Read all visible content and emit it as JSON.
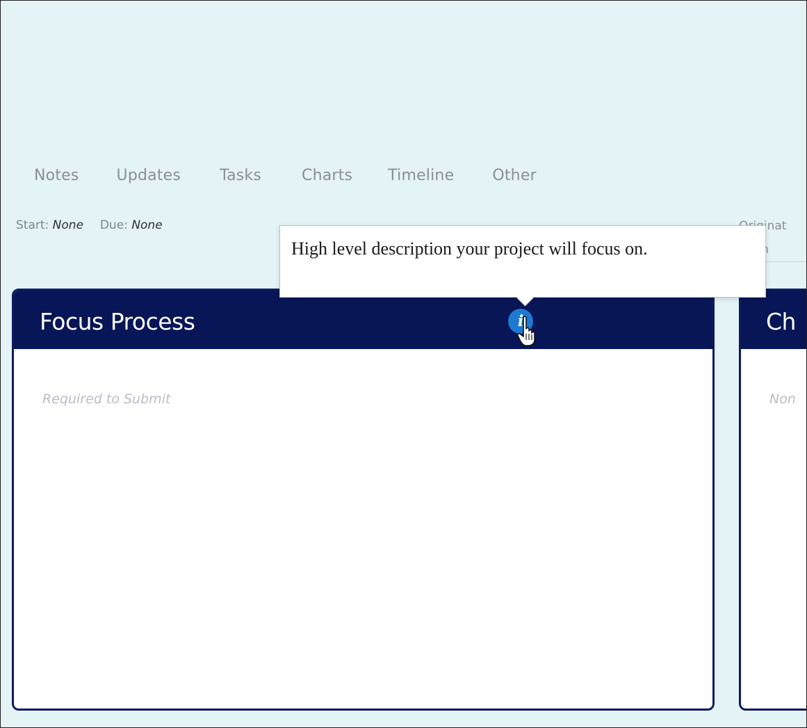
{
  "tabs": [
    {
      "label": "Notes"
    },
    {
      "label": "Updates"
    },
    {
      "label": "Tasks"
    },
    {
      "label": "Charts"
    },
    {
      "label": "Timeline"
    },
    {
      "label": "Other"
    }
  ],
  "meta": {
    "start_label": "Start:",
    "start_value": "None",
    "due_label": "Due:",
    "due_value": "None"
  },
  "right_fields": {
    "line1": "Originat",
    "line2": "ation"
  },
  "cards": {
    "focus": {
      "title": "Focus Process",
      "placeholder": "Required to Submit",
      "info_glyph": "i"
    },
    "second": {
      "title": "Ch",
      "placeholder": "Non"
    }
  },
  "tooltip": {
    "text": "High level description your project will focus on."
  },
  "icons": {
    "info": "info-icon",
    "cursor": "hand-pointer-icon"
  },
  "colors": {
    "background": "#e4f3f6",
    "card_header": "#081657",
    "card_border": "#0d1a5c",
    "info_button": "#1e7ad1",
    "tab_text": "#8a8f97"
  }
}
